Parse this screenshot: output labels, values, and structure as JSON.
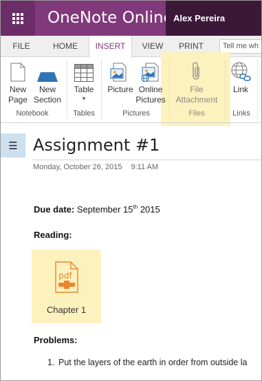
{
  "app": {
    "title": "OneNote Online",
    "user_name": "Alex Pereira",
    "colors": {
      "brand": "#80397b",
      "brand_dark": "#6a2d67",
      "user_bg": "#3b1838",
      "highlight": "#fdf1bd",
      "pdf_icon": "#e8862e"
    }
  },
  "tabs": [
    {
      "label": "FILE",
      "active": false
    },
    {
      "label": "HOME",
      "active": false
    },
    {
      "label": "INSERT",
      "active": true
    },
    {
      "label": "VIEW",
      "active": false
    },
    {
      "label": "PRINT",
      "active": false
    }
  ],
  "tell_me": {
    "placeholder": "Tell me wh"
  },
  "ribbon": {
    "new_page": "New Page",
    "new_section": "New Section",
    "table": "Table",
    "picture": "Picture",
    "online_pictures": "Online Pictures",
    "file_attachment": "File Attachment",
    "link": "Link",
    "groups": {
      "notebook": "Notebook",
      "tables": "Tables",
      "pictures": "Pictures",
      "files": "Files",
      "links": "Links"
    },
    "icons": {
      "new_page": "blank-page-icon",
      "new_section": "section-tab-icon",
      "table": "table-grid-icon",
      "picture": "picture-icon",
      "online_pictures": "online-pictures-icon",
      "file_attachment": "paperclip-icon",
      "link": "globe-link-icon"
    }
  },
  "page": {
    "nav_icon": "hamburger-icon",
    "title": "Assignment #1",
    "date": "Monday, October 26, 2015",
    "time": "9:11 AM",
    "due_label": "Due date:",
    "due_value_pre": "September 15",
    "due_value_sup": "th",
    "due_value_post": " 2015",
    "reading_label": "Reading:",
    "attachment": {
      "label": "Chapter 1",
      "icon": "pdf-file-icon",
      "icon_text": "pdf"
    },
    "problems_label": "Problems:",
    "problems": [
      {
        "number": "1.",
        "text": "Put the layers of the earth in order from outside la"
      }
    ]
  }
}
